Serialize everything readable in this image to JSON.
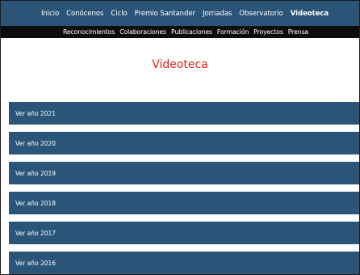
{
  "top_nav": {
    "items": [
      {
        "label": "Inicio"
      },
      {
        "label": "Conócenos"
      },
      {
        "label": "Ciclo"
      },
      {
        "label": "Premio Santander"
      },
      {
        "label": "Jornadas"
      },
      {
        "label": "Observatorio"
      },
      {
        "label": "Videoteca",
        "active": true
      }
    ]
  },
  "sub_nav": {
    "items": [
      {
        "label": "Reconocimientos"
      },
      {
        "label": "Colaboraciones"
      },
      {
        "label": "Publicaciones"
      },
      {
        "label": "Formación"
      },
      {
        "label": "Proyectos"
      },
      {
        "label": "Prensa"
      }
    ]
  },
  "main": {
    "title": "Videoteca",
    "years": [
      {
        "label": "Ver año 2021"
      },
      {
        "label": "Ver año 2020"
      },
      {
        "label": "Ver año 2019"
      },
      {
        "label": "Ver año 2018"
      },
      {
        "label": "Ver año 2017"
      },
      {
        "label": "Ver año 2016"
      }
    ]
  },
  "colors": {
    "nav_bg": "#2b5578",
    "subnav_bg": "#0d0d0d",
    "title_color": "#e2231a",
    "year_bg": "#2b5578"
  }
}
